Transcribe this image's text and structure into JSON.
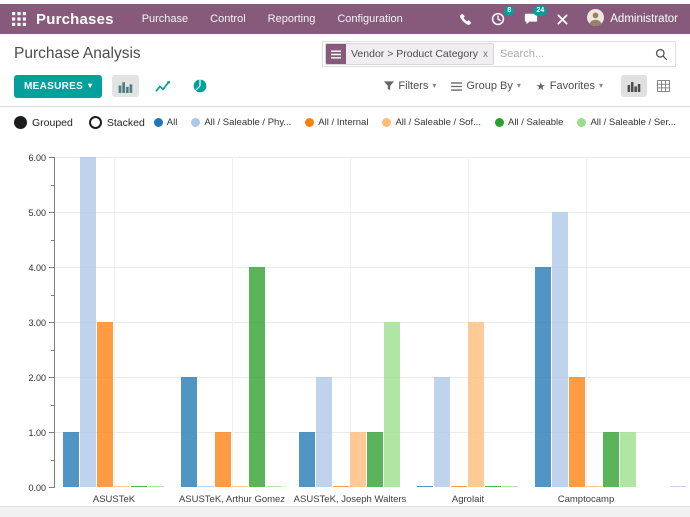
{
  "colors": {
    "topbar": "#875A7B",
    "accent": "#00A09D",
    "grid": "#ebebeb",
    "axis": "#7d7d7d"
  },
  "app": {
    "name": "Purchases",
    "menus": [
      "Purchase",
      "Control",
      "Reporting",
      "Configuration"
    ],
    "user": "Administrator",
    "badges": {
      "activities": "8",
      "messages": "24"
    }
  },
  "control_panel": {
    "title": "Purchase Analysis",
    "measures_label": "MEASURES",
    "search": {
      "facet": "Vendor > Product Category",
      "facet_remove": "x",
      "placeholder": "Search..."
    },
    "filters_label": "Filters",
    "groupby_label": "Group By",
    "favorites_label": "Favorites"
  },
  "chart_toolbar": {
    "mode_grouped": "Grouped",
    "mode_stacked": "Stacked"
  },
  "chart_data": {
    "type": "bar",
    "title": "Purchase Analysis",
    "mode": "grouped",
    "categories": [
      "ASUSTeK",
      "ASUSTeK, Arthur Gomez",
      "ASUSTeK, Joseph Walters",
      "Agrolait",
      "Camptocamp",
      ""
    ],
    "series": [
      {
        "name": "All",
        "color": "#1f77b4",
        "values": [
          1,
          2,
          1,
          0.02,
          4,
          0
        ]
      },
      {
        "name": "All / Saleable / Phy...",
        "color": "#aec7e8",
        "values": [
          6,
          0.02,
          2,
          2,
          5,
          0.02
        ]
      },
      {
        "name": "All / Internal",
        "color": "#ff7f0e",
        "values": [
          3,
          1,
          0.02,
          0.02,
          2,
          0
        ]
      },
      {
        "name": "All / Saleable / Sof...",
        "color": "#ffbb78",
        "values": [
          0.02,
          0.02,
          1,
          3,
          0.02,
          0
        ]
      },
      {
        "name": "All / Saleable",
        "color": "#2ca02c",
        "values": [
          0.02,
          4,
          1,
          0.02,
          1,
          0
        ]
      },
      {
        "name": "All / Saleable / Ser...",
        "color": "#98df8a",
        "values": [
          0.02,
          0.02,
          3,
          0.02,
          1,
          0
        ]
      }
    ],
    "xlabel": "",
    "ylabel": "",
    "ylim": [
      0,
      6
    ],
    "ytick_step": 1,
    "ytick_labels": [
      "0.00",
      "1.00",
      "2.00",
      "3.00",
      "4.00",
      "5.00",
      "6.00"
    ],
    "grid": true,
    "legend_position": "top-right"
  }
}
